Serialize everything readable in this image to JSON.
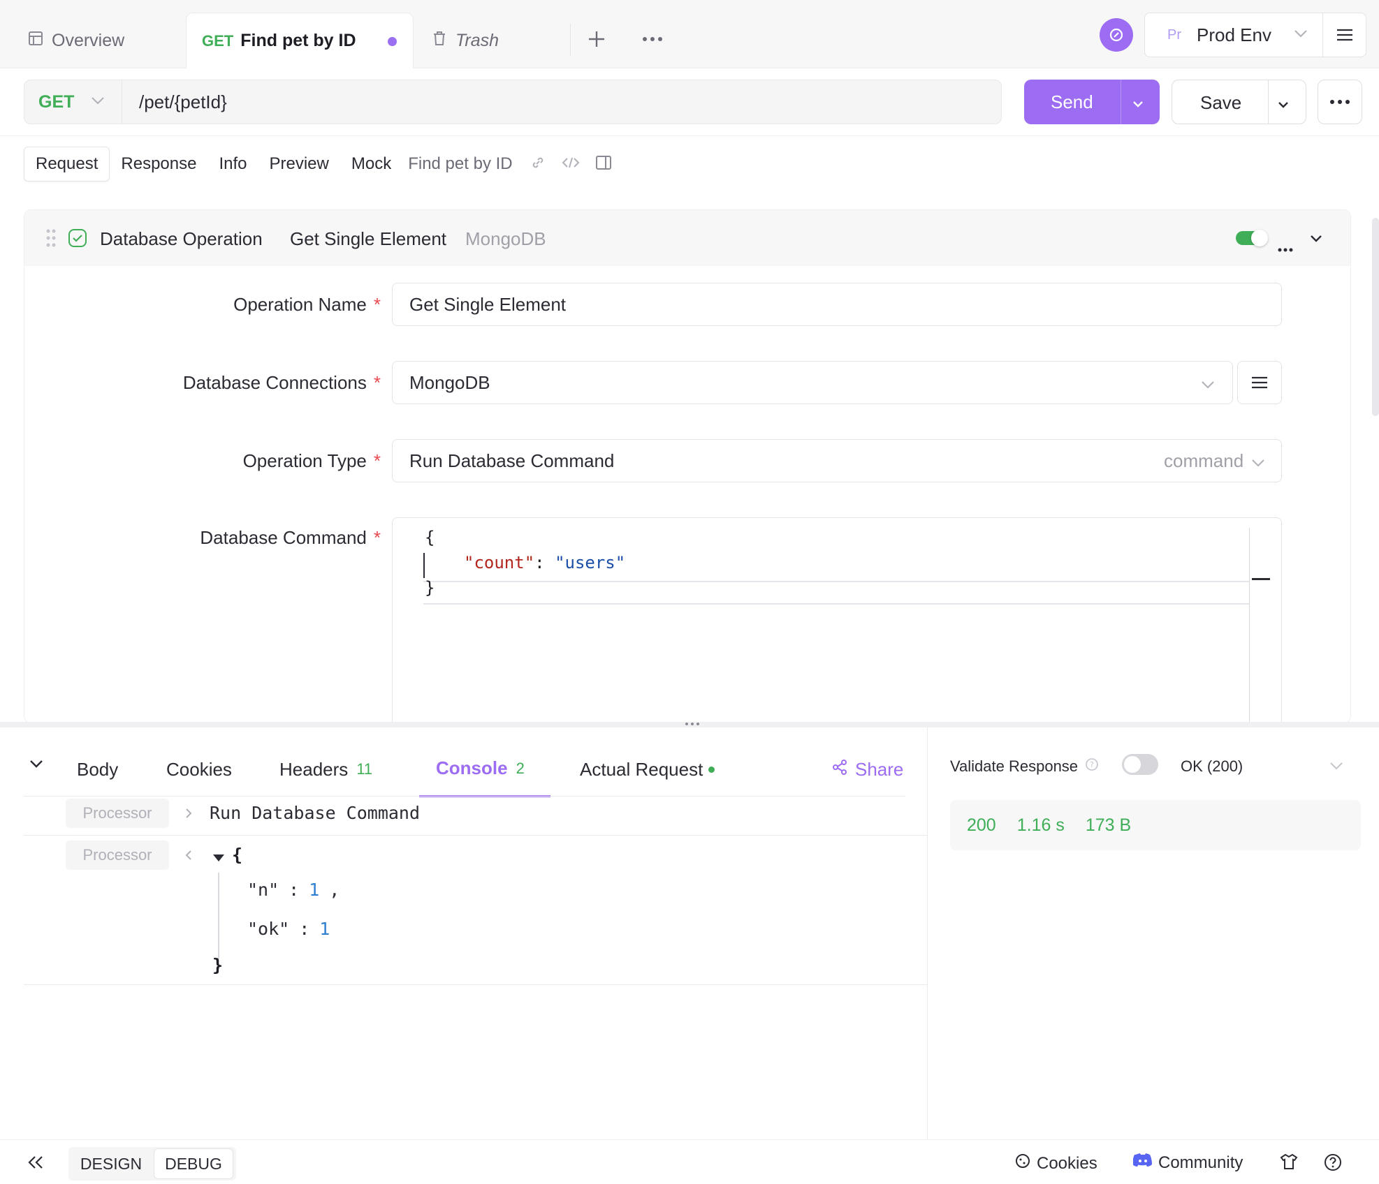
{
  "tabs": [
    {
      "label": "Overview",
      "icon": "layout-icon"
    },
    {
      "method": "GET",
      "label": "Find pet by ID",
      "modified": true
    },
    {
      "label": "Trash",
      "icon": "trash-icon"
    }
  ],
  "env": {
    "badge": "Pr",
    "name": "Prod Env"
  },
  "request": {
    "method": "GET",
    "url": "/pet/{petId}",
    "send_label": "Send",
    "save_label": "Save"
  },
  "subtabs": [
    "Request",
    "Response",
    "Info",
    "Preview",
    "Mock"
  ],
  "subtab_title": "Find pet by ID",
  "processor": {
    "title": "Database Operation",
    "name": "Get Single Element",
    "db": "MongoDB",
    "fields": {
      "operation_name_label": "Operation Name",
      "operation_name_value": "Get Single Element",
      "db_conn_label": "Database Connections",
      "db_conn_value": "MongoDB",
      "op_type_label": "Operation Type",
      "op_type_value": "Run Database Command",
      "op_type_hint": "command",
      "db_command_label": "Database Command",
      "required_mark": "*"
    },
    "code": {
      "open": "{",
      "key": "\"count\"",
      "colon": ":",
      "value": "\"users\"",
      "close": "}"
    }
  },
  "response_tabs": {
    "body": "Body",
    "cookies": "Cookies",
    "headers": "Headers",
    "headers_count": "11",
    "console": "Console",
    "console_count": "2",
    "actual": "Actual Request",
    "share": "Share"
  },
  "console": {
    "tag": "Processor",
    "row1_text": "Run Database Command",
    "json_open": "{",
    "n_key": "\"n\"",
    "n_val": "1",
    "ok_key": "\"ok\"",
    "ok_val": "1",
    "json_close": "}",
    "colon": ":",
    "comma": ","
  },
  "validate": {
    "label": "Validate Response",
    "status": "OK (200)",
    "code": "200",
    "time": "1.16 s",
    "size": "173 B"
  },
  "footer": {
    "design": "DESIGN",
    "debug": "DEBUG",
    "cookies": "Cookies",
    "community": "Community"
  },
  "colors": {
    "accent": "#9c6cf2",
    "get": "#3fae57",
    "success": "#3fae57"
  }
}
